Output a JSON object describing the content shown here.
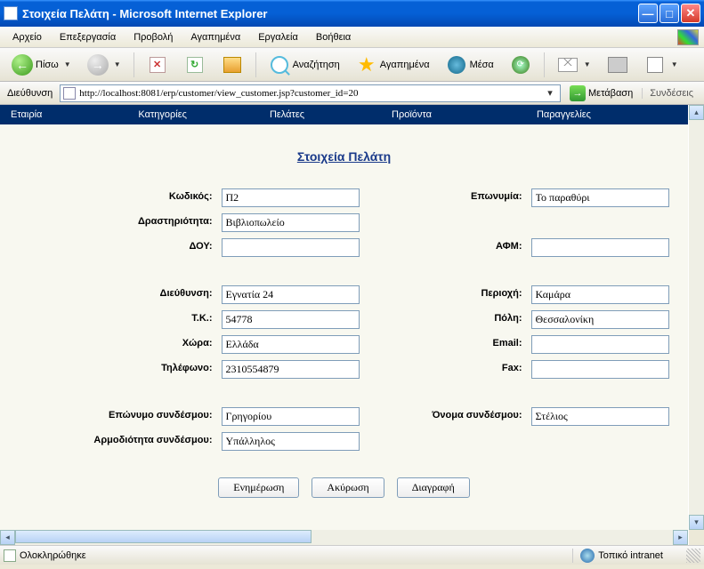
{
  "window": {
    "title": "Στοιχεία Πελάτη - Microsoft Internet Explorer"
  },
  "menu": {
    "file": "Αρχείο",
    "edit": "Επεξεργασία",
    "view": "Προβολή",
    "favorites": "Αγαπημένα",
    "tools": "Εργαλεία",
    "help": "Βοήθεια"
  },
  "toolbar": {
    "back": "Πίσω",
    "search": "Αναζήτηση",
    "favorites": "Αγαπημένα",
    "media": "Μέσα"
  },
  "address": {
    "label": "Διεύθυνση",
    "url": "http://localhost:8081/erp/customer/view_customer.jsp?customer_id=20",
    "go": "Μετάβαση",
    "links": "Συνδέσεις"
  },
  "nav": {
    "company": "Εταιρία",
    "categories": "Κατηγορίες",
    "customers": "Πελάτες",
    "products": "Προϊόντα",
    "orders": "Παραγγελίες"
  },
  "page": {
    "title": "Στοιχεία Πελάτη"
  },
  "form": {
    "labels": {
      "code": "Κωδικός:",
      "name": "Επωνυμία:",
      "activity": "Δραστηριότητα:",
      "tax_office": "ΔΟΥ:",
      "vat": "ΑΦΜ:",
      "address": "Διεύθυνση:",
      "region": "Περιοχή:",
      "postal": "Τ.Κ.:",
      "city": "Πόλη:",
      "country": "Χώρα:",
      "email": "Email:",
      "phone": "Τηλέφωνο:",
      "fax": "Fax:",
      "contact_lastname": "Επώνυμο συνδέσμου:",
      "contact_firstname": "Όνομα συνδέσμου:",
      "contact_role": "Αρμοδιότητα συνδέσμου:"
    },
    "values": {
      "code": "Π2",
      "name": "Το παραθύρι",
      "activity": "Βιβλιοπωλείο",
      "tax_office": "",
      "vat": "",
      "address": "Εγνατία 24",
      "region": "Καμάρα",
      "postal": "54778",
      "city": "Θεσσαλονίκη",
      "country": "Ελλάδα",
      "email": "",
      "phone": "2310554879",
      "fax": "",
      "contact_lastname": "Γρηγορίου",
      "contact_firstname": "Στέλιος",
      "contact_role": "Υπάλληλος"
    }
  },
  "buttons": {
    "update": "Ενημέρωση",
    "cancel": "Ακύρωση",
    "delete": "Διαγραφή"
  },
  "status": {
    "text": "Ολοκληρώθηκε",
    "zone": "Τοπικό intranet"
  }
}
